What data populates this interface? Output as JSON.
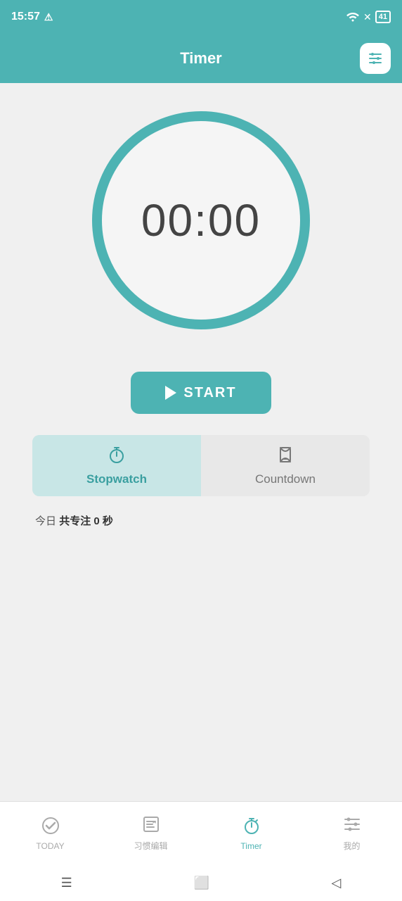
{
  "statusBar": {
    "time": "15:57",
    "battery": "41"
  },
  "header": {
    "title": "Timer",
    "settingsLabel": "settings"
  },
  "timer": {
    "display": "00:00"
  },
  "startButton": {
    "label": "START"
  },
  "tabs": [
    {
      "id": "stopwatch",
      "label": "Stopwatch",
      "active": true
    },
    {
      "id": "countdown",
      "label": "Countdown",
      "active": false
    }
  ],
  "dailyStats": {
    "prefix": "今日",
    "highlight": "共专注 0 秒"
  },
  "bottomNav": [
    {
      "id": "today",
      "label": "TODAY",
      "active": false
    },
    {
      "id": "habit-edit",
      "label": "习惯编辑",
      "active": false
    },
    {
      "id": "timer",
      "label": "Timer",
      "active": true
    },
    {
      "id": "mine",
      "label": "我的",
      "active": false
    }
  ]
}
